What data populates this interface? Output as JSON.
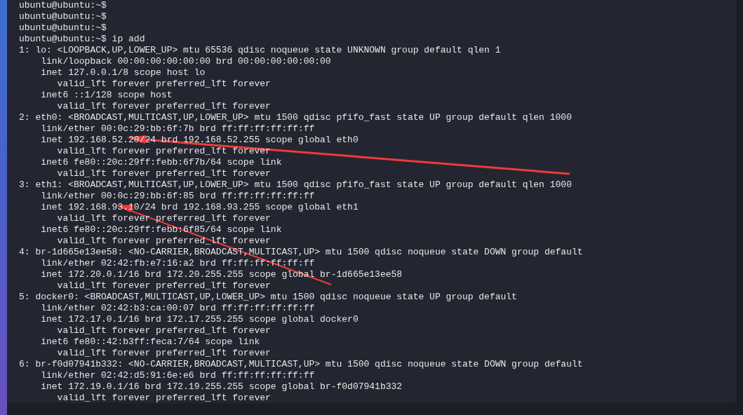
{
  "terminal": {
    "lines": [
      "ubuntu@ubuntu:~$",
      "ubuntu@ubuntu:~$",
      "ubuntu@ubuntu:~$",
      "ubuntu@ubuntu:~$ ip add",
      "1: lo: <LOOPBACK,UP,LOWER_UP> mtu 65536 qdisc noqueue state UNKNOWN group default qlen 1",
      "    link/loopback 00:00:00:00:00:00 brd 00:00:00:00:00:00",
      "    inet 127.0.0.1/8 scope host lo",
      "       valid_lft forever preferred_lft forever",
      "    inet6 ::1/128 scope host",
      "       valid_lft forever preferred_lft forever",
      "2: eth0: <BROADCAST,MULTICAST,UP,LOWER_UP> mtu 1500 qdisc pfifo_fast state UP group default qlen 1000",
      "    link/ether 00:0c:29:bb:6f:7b brd ff:ff:ff:ff:ff:ff",
      "    inet 192.168.52.20/24 brd 192.168.52.255 scope global eth0",
      "       valid_lft forever preferred_lft forever",
      "    inet6 fe80::20c:29ff:febb:6f7b/64 scope link",
      "       valid_lft forever preferred_lft forever",
      "3: eth1: <BROADCAST,MULTICAST,UP,LOWER_UP> mtu 1500 qdisc pfifo_fast state UP group default qlen 1000",
      "    link/ether 00:0c:29:bb:6f:85 brd ff:ff:ff:ff:ff:ff",
      "    inet 192.168.93.10/24 brd 192.168.93.255 scope global eth1",
      "       valid_lft forever preferred_lft forever",
      "    inet6 fe80::20c:29ff:febb:6f85/64 scope link",
      "       valid_lft forever preferred_lft forever",
      "4: br-1d665e13ee58: <NO-CARRIER,BROADCAST,MULTICAST,UP> mtu 1500 qdisc noqueue state DOWN group default",
      "    link/ether 02:42:fb:e7:16:a2 brd ff:ff:ff:ff:ff:ff",
      "    inet 172.20.0.1/16 brd 172.20.255.255 scope global br-1d665e13ee58",
      "       valid_lft forever preferred_lft forever",
      "5: docker0: <BROADCAST,MULTICAST,UP,LOWER_UP> mtu 1500 qdisc noqueue state UP group default",
      "    link/ether 02:42:b3:ca:00:07 brd ff:ff:ff:ff:ff:ff",
      "    inet 172.17.0.1/16 brd 172.17.255.255 scope global docker0",
      "       valid_lft forever preferred_lft forever",
      "    inet6 fe80::42:b3ff:feca:7/64 scope link",
      "       valid_lft forever preferred_lft forever",
      "6: br-f0d07941b332: <NO-CARRIER,BROADCAST,MULTICAST,UP> mtu 1500 qdisc noqueue state DOWN group default",
      "    link/ether 02:42:d5:91:6e:e6 brd ff:ff:ff:ff:ff:ff",
      "    inet 172.19.0.1/16 brd 172.19.255.255 scope global br-f0d07941b332",
      "       valid_lft forever preferred_lft forever"
    ]
  }
}
